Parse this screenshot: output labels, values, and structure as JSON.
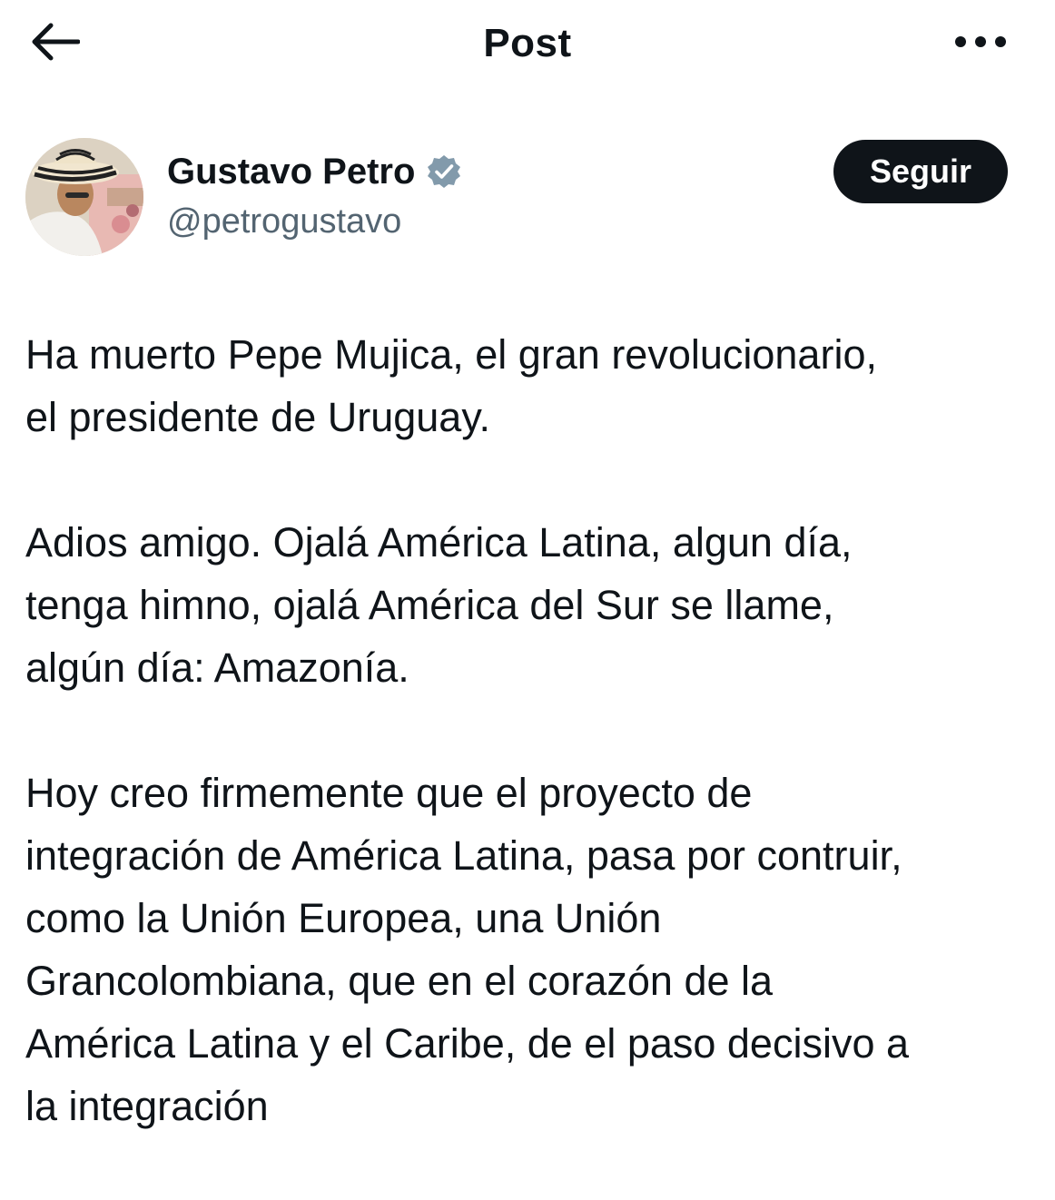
{
  "header": {
    "title": "Post",
    "back_icon": "arrow-left-icon",
    "more_icon": "more-horizontal-icon"
  },
  "author": {
    "display_name": "Gustavo Petro",
    "handle": "@petrogustavo",
    "verified_icon": "verified-badge-icon",
    "verified_color": "#829aab",
    "follow_label": "Seguir"
  },
  "post": {
    "paragraphs": [
      {
        "lines": [
          "Ha muerto Pepe Mujica, el gran revolucionario,",
          "el presidente de Uruguay."
        ]
      },
      {
        "lines": [
          "Adios amigo. Ojalá América Latina, algun día,",
          "tenga himno, ojalá América del Sur se llame,",
          "algún día: Amazonía."
        ]
      },
      {
        "lines": [
          "Hoy creo firmemente que el proyecto de",
          "integración de América Latina, pasa por contruir,",
          "como la Unión Europea, una Unión",
          "Grancolombiana, que en el corazón de la",
          "América Latina y el Caribe, de el paso decisivo a",
          "la integración"
        ]
      }
    ]
  }
}
